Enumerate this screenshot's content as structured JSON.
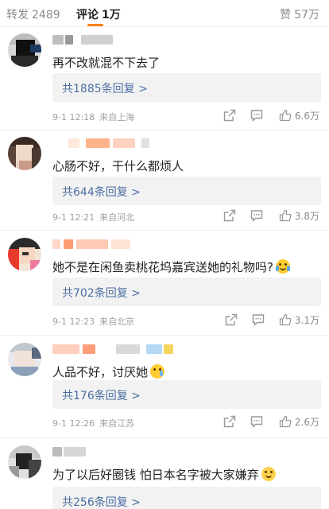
{
  "header": {
    "forward_label": "转发",
    "forward_count": "2489",
    "comments_label": "评论",
    "comments_count": "1万",
    "likes_label": "赞",
    "likes_count": "57万",
    "accent_color": "#ff8200"
  },
  "comments": [
    {
      "text": "再不改就混不下去了",
      "reply_label": "共1885条回复 >",
      "time": "9-1 12:18",
      "location": "来自上海",
      "likes": "6.6万",
      "emoji": ""
    },
    {
      "text": "心肠不好，干什么都烦人",
      "reply_label": "共644条回复 >",
      "time": "9-1 12:21",
      "location": "来自河北",
      "likes": "3.8万",
      "emoji": ""
    },
    {
      "text": "她不是在闲鱼卖桃花坞嘉宾送她的礼物吗?",
      "reply_label": "共702条回复 >",
      "time": "9-1 12:23",
      "location": "来自北京",
      "likes": "3.1万",
      "emoji": "crying-laugh-emoji"
    },
    {
      "text": "人品不好，讨厌她",
      "reply_label": "共176条回复 >",
      "time": "9-1 12:26",
      "location": "来自江苏",
      "likes": "2.6万",
      "emoji": "crying-emoji"
    },
    {
      "text": "为了以后好圈钱 怕日本名字被大家嫌弃",
      "reply_label": "共256条回复 >",
      "time": "",
      "location": "",
      "likes": "",
      "emoji": "smile-emoji"
    }
  ],
  "icons": {
    "share": "share-icon",
    "comment": "comment-icon",
    "like": "thumbs-up-icon"
  }
}
